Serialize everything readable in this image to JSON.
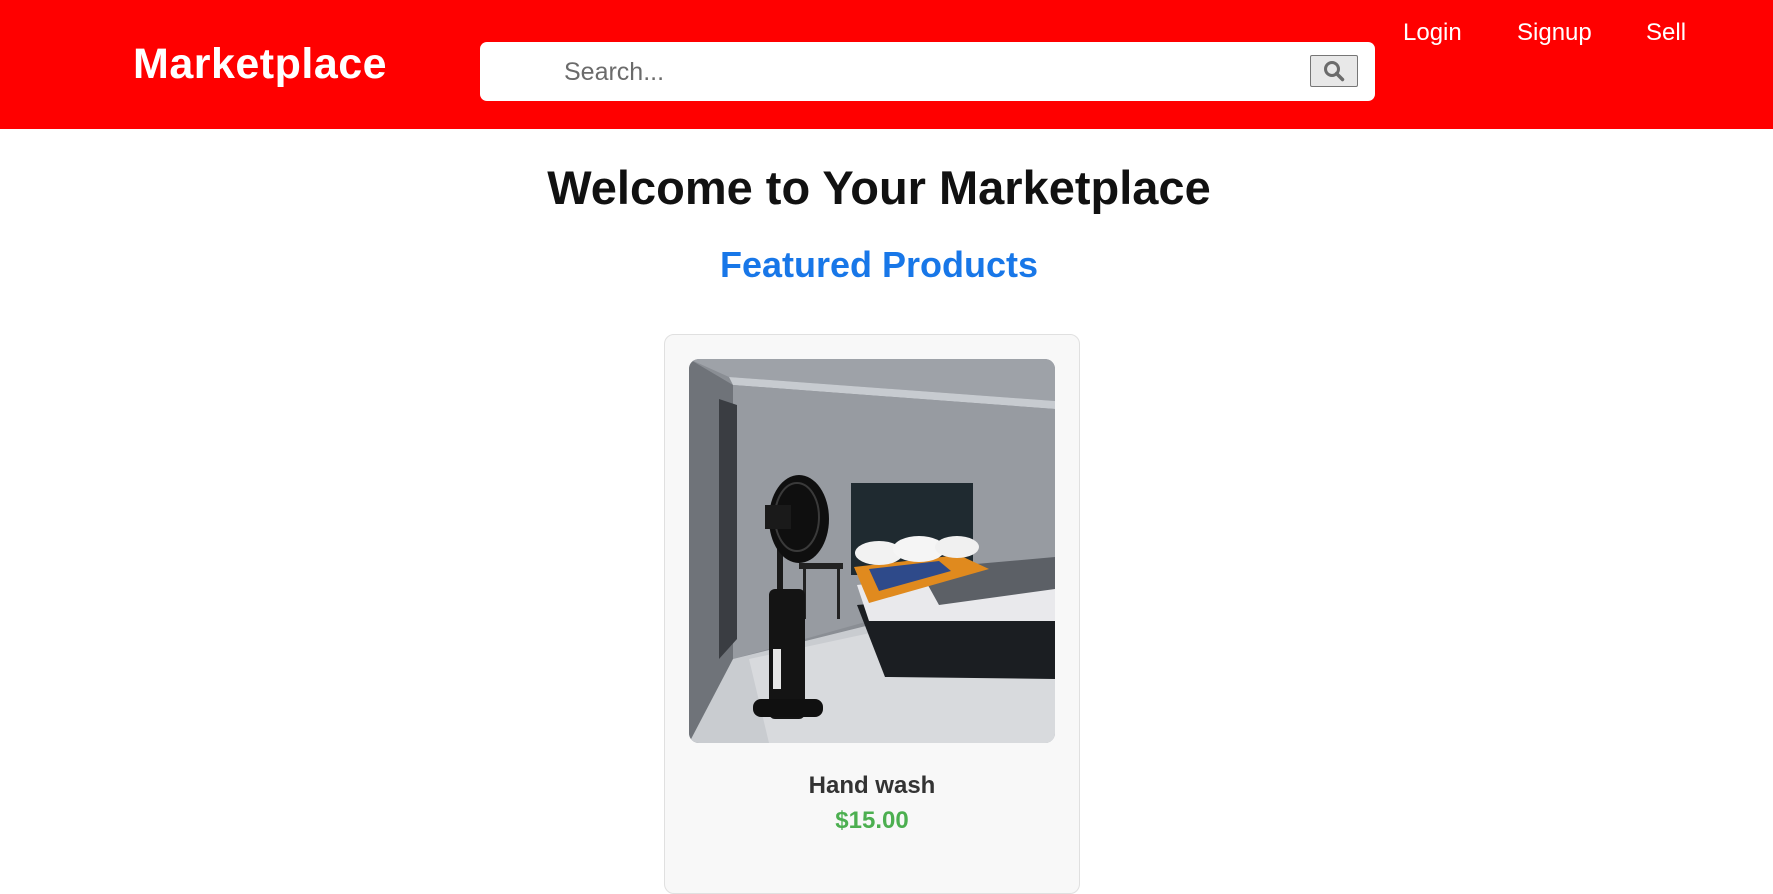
{
  "header": {
    "brand": "Marketplace",
    "search_placeholder": "Search...",
    "search_icon": "search-icon",
    "nav": {
      "login": "Login",
      "signup": "Signup",
      "sell": "Sell"
    },
    "background_color": "#ff0000"
  },
  "main": {
    "welcome_title": "Welcome to Your Marketplace",
    "featured_title": "Featured Products",
    "featured_color": "#1877e8"
  },
  "products": [
    {
      "name": "Hand wash",
      "price": "$15.00",
      "price_color": "#4caf50"
    }
  ]
}
